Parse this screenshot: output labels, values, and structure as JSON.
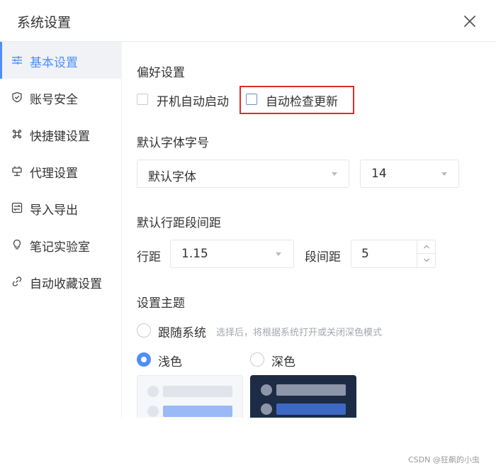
{
  "dialog": {
    "title": "系统设置"
  },
  "sidebar": {
    "items": [
      {
        "label": "基本设置",
        "icon": "sliders-icon"
      },
      {
        "label": "账号安全",
        "icon": "shield-icon"
      },
      {
        "label": "快捷键设置",
        "icon": "command-icon"
      },
      {
        "label": "代理设置",
        "icon": "plug-icon"
      },
      {
        "label": "导入导出",
        "icon": "import-export-icon"
      },
      {
        "label": "笔记实验室",
        "icon": "bulb-icon"
      },
      {
        "label": "自动收藏设置",
        "icon": "link-icon"
      }
    ],
    "active_index": 0
  },
  "preferences": {
    "title": "偏好设置",
    "autostart_label": "开机自动启动",
    "autostart_checked": false,
    "auto_update_label": "自动检查更新",
    "auto_update_checked": false
  },
  "font": {
    "title": "默认字体字号",
    "family_value": "默认字体",
    "size_value": "14"
  },
  "spacing": {
    "title": "默认行距段间距",
    "line_label": "行距",
    "line_value": "1.15",
    "paragraph_label": "段间距",
    "paragraph_value": "5"
  },
  "theme": {
    "title": "设置主题",
    "follow_label": "跟随系统",
    "follow_hint": "选择后，将根据系统打开或关闭深色模式",
    "light_label": "浅色",
    "dark_label": "深色",
    "selected": "light"
  },
  "colors": {
    "accent": "#4f8ef7",
    "highlight": "#e02b2b",
    "dark_theme_bg": "#1d2b45"
  },
  "watermark": "CSDN @狂飙的小虫"
}
